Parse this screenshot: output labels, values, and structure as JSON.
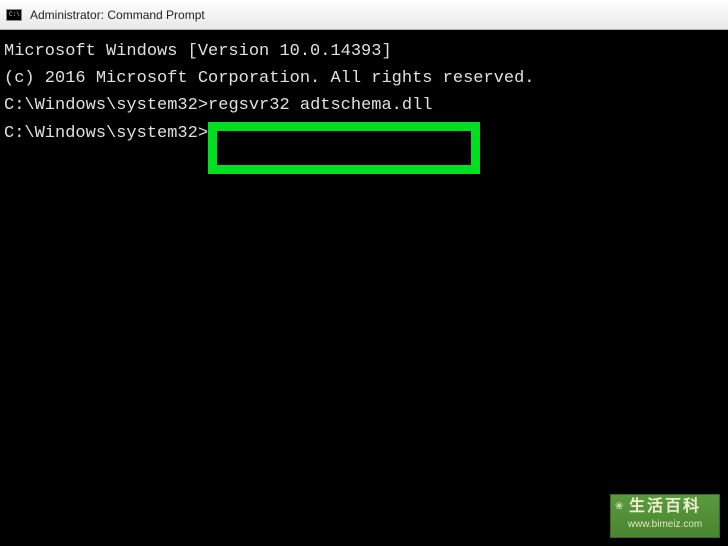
{
  "titlebar": {
    "title": "Administrator: Command Prompt"
  },
  "terminal": {
    "line1": "Microsoft Windows [Version 10.0.14393]",
    "line2": "(c) 2016 Microsoft Corporation. All rights reserved.",
    "line3": "",
    "prompt1": "C:\\Windows\\system32>",
    "command1": "regsvr32 adtschema.dll",
    "line5": "",
    "prompt2": "C:\\Windows\\system32>"
  },
  "watermark": {
    "text_cn": "生活百科",
    "url": "www.bimeiz.com"
  }
}
